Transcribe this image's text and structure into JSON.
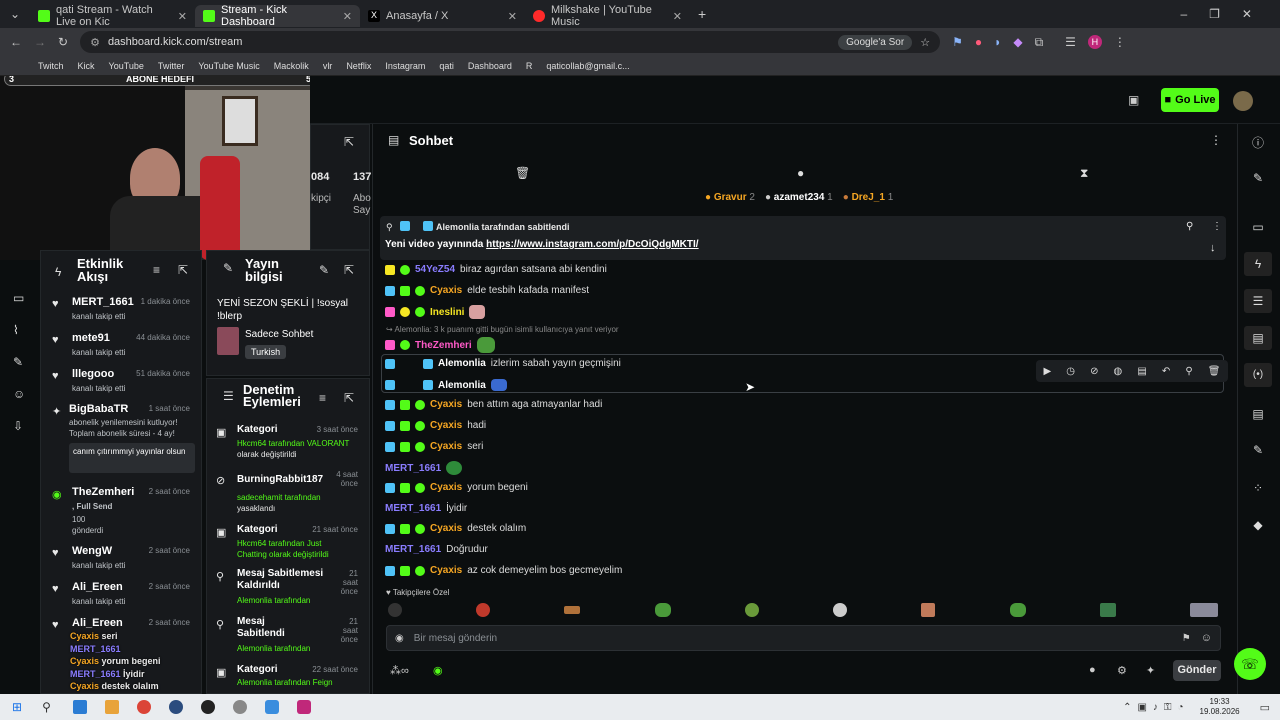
{
  "tabs": [
    {
      "label": "qati Stream - Watch Live on Kic",
      "color": "#53fc18"
    },
    {
      "label": "Stream - Kick Dashboard",
      "color": "#53fc18"
    },
    {
      "label": "Anasayfa / X",
      "color": "#ffffff"
    },
    {
      "label": "Milkshake | YouTube Music",
      "color": "#ff2a2a"
    }
  ],
  "address": {
    "url": "dashboard.kick.com/stream",
    "google_ask": "Google'a Sor"
  },
  "bookmarks": [
    "Twitch",
    "Kick",
    "YouTube",
    "Twitter",
    "YouTube Music",
    "Mackolik",
    "vlr",
    "Netflix",
    "Instagram",
    "qati",
    "Dashboard",
    "R",
    "qaticollab@gmail.c..."
  ],
  "webcam": {
    "goal_title": "ABONE HEDEFİ",
    "goal_left": "3",
    "goal_right": "5"
  },
  "header": {
    "go_live": "Go Live"
  },
  "stats": {
    "v1": "084",
    "v2": "137",
    "l1": "kipçi",
    "l2": "Abo",
    "l3": "Say"
  },
  "activity": {
    "title": "Etkinlik Akışı",
    "items": [
      {
        "user": "MERT_1661",
        "time": "1 dakika önce",
        "sub": "kanalı takip etti"
      },
      {
        "user": "mete91",
        "time": "44 dakika önce",
        "sub": "kanalı takip etti"
      },
      {
        "user": "lllegooo",
        "time": "51 dakika önce",
        "sub": "kanalı takip etti"
      },
      {
        "user": "BigBabaTR",
        "time": "1 saat önce",
        "sub": "abonelik yenilemesini kutluyor! Toplam abonelik süresi - 4 ay!",
        "quote": "canım çıtırımmıyi yayınlar olsun"
      },
      {
        "user": "TheZemheri",
        "time": "2 saat önce",
        "sub": ", Full Send",
        "extra": "100 gönderdi"
      },
      {
        "user": "WengW",
        "time": "2 saat önce",
        "sub": "kanalı takip etti"
      },
      {
        "user": "Ali_Ereen",
        "time": "2 saat önce",
        "sub": "kanalı takip etti"
      },
      {
        "user": "Ali_Ereen",
        "time": "2 saat önce",
        "sub": ""
      }
    ]
  },
  "stream_info": {
    "title": "Yayın bilgisi",
    "stream_title": "YENİ SEZON ŞEKLİ | !sosyal !blerp",
    "category": "Sadece Sohbet",
    "language": "Turkish"
  },
  "mod_actions": {
    "title": "Denetim Eylemleri",
    "items": [
      {
        "title": "Kategori",
        "time": "3 saat önce",
        "line1": "Hkcm64 tarafından VALORANT",
        "line2": "olarak değiştirildi"
      },
      {
        "title": "BurningRabbit187",
        "time": "4 saat önce",
        "line1": "sadecehamit tarafından",
        "line2": "yasaklandı"
      },
      {
        "title": "Kategori",
        "time": "21 saat önce",
        "line1": "Hkcm64 tarafından Just Chatting olarak değiştirildi",
        "line2": ""
      },
      {
        "title": "Mesaj Sabitlemesi Kaldırıldı",
        "time": "21 saat önce",
        "line1": "Alemonlia tarafından",
        "line2": ""
      },
      {
        "title": "Mesaj Sabitlendi",
        "time": "21 saat önce",
        "line1": "Alemonlia tarafından",
        "line2": ""
      },
      {
        "title": "Kategori",
        "time": "22 saat önce",
        "line1": "Alemonlia tarafından Feign",
        "line2": ""
      }
    ]
  },
  "chat": {
    "title": "Sohbet",
    "top_gifters": [
      {
        "name": "Gravur",
        "n": "2"
      },
      {
        "name": "azamet234",
        "n": "1"
      },
      {
        "name": "DreJ_1",
        "n": "1"
      }
    ],
    "pinned": {
      "by": "Alemonlia tarafından sabitlendi",
      "text": "Yeni video yayınında ",
      "link": "https://www.instagram.com/p/DcOiQdgMKTI/"
    },
    "reply_note": "Alemonlia: 3 k puanım gitti bugün isimli kullanıcıya yanıt veriyor",
    "messages": [
      {
        "user": "54YeZ54",
        "text": "biraz agırdan satsana abi kendini",
        "color": "#8a7dff"
      },
      {
        "user": "Cyaxis",
        "text": "elde tesbih kafada manifest",
        "color": "#f5a623"
      },
      {
        "user": "Ineslini",
        "text": "",
        "color": "#f5e623"
      },
      {
        "user": "TheZemheri",
        "text": "",
        "color": "#ff5ac8"
      },
      {
        "user": "Alemonlia",
        "text": "izlerim sabah yayın geçmişini",
        "color": "#ffffff"
      },
      {
        "user": "Alemonlia",
        "text": "",
        "color": "#ffffff"
      },
      {
        "user": "Cyaxis",
        "text": "ben attım aga atmayanlar hadi",
        "color": "#f5a623"
      },
      {
        "user": "Cyaxis",
        "text": "hadi",
        "color": "#f5a623"
      },
      {
        "user": "Cyaxis",
        "text": "seri",
        "color": "#f5a623"
      },
      {
        "user": "MERT_1661",
        "text": "",
        "color": "#8a7dff"
      },
      {
        "user": "Cyaxis",
        "text": "yorum begeni",
        "color": "#f5a623"
      },
      {
        "user": "MERT_1661",
        "text": "İyidir",
        "color": "#8a7dff"
      },
      {
        "user": "Cyaxis",
        "text": "destek olalım",
        "color": "#f5a623"
      },
      {
        "user": "MERT_1661",
        "text": "Doğrudur",
        "color": "#8a7dff"
      },
      {
        "user": "Cyaxis",
        "text": "az cok demeyelim bos gecmeyelim",
        "color": "#f5a623"
      }
    ],
    "followers_only": "Takipçilere Özel",
    "input_placeholder": "Bir mesaj gönderin",
    "send": "Gönder"
  },
  "overlay_chat": [
    {
      "user": "Cyaxis",
      "text": "seri"
    },
    {
      "user": "MERT_1661",
      "text": ""
    },
    {
      "user": "Cyaxis",
      "text": "yorum begeni"
    },
    {
      "user": "MERT_1661",
      "text": "İyidir"
    },
    {
      "user": "Cyaxis",
      "text": "destek olalım"
    }
  ],
  "taskbar": {
    "time": "19:33",
    "date": "19.08.2026"
  }
}
